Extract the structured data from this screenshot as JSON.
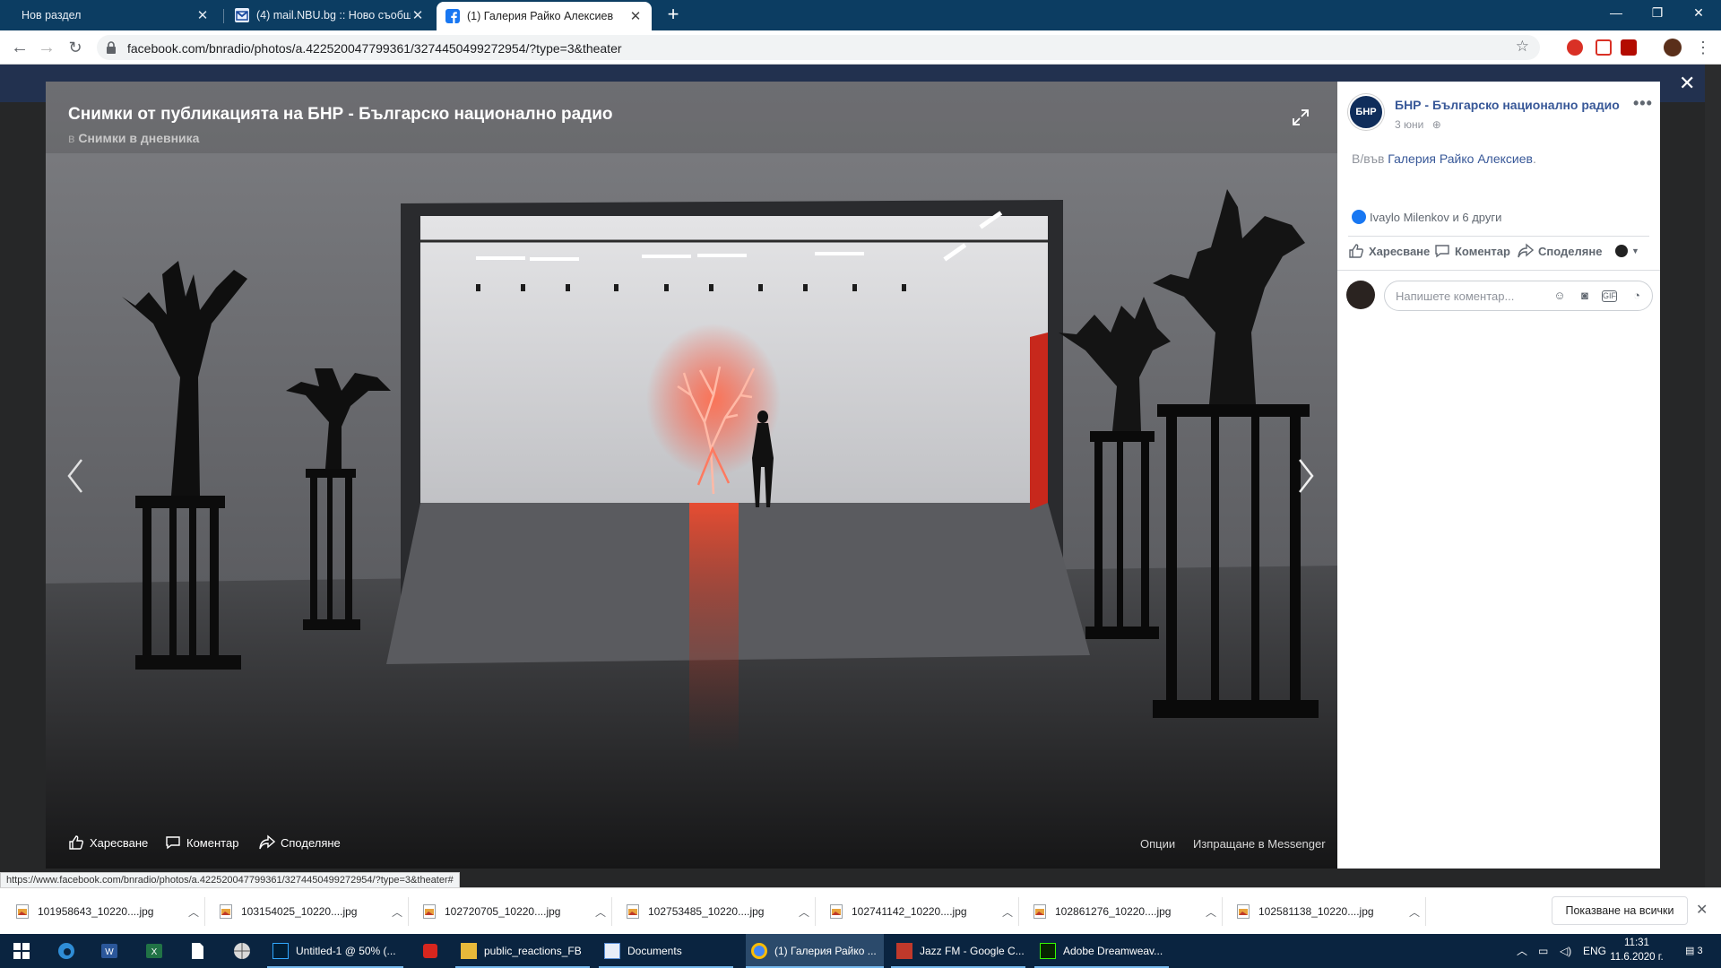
{
  "browser": {
    "tabs": [
      {
        "label": "Нов раздел",
        "active": false
      },
      {
        "label": "(4) mail.NBU.bg :: Ново съобщен",
        "active": false
      },
      {
        "label": "(1) Галерия Райко Алексиев",
        "active": true
      }
    ],
    "url": "facebook.com/bnradio/photos/a.422520047799361/3274450499272954/?type=3&theater",
    "status_url": "https://www.facebook.com/bnradio/photos/a.422520047799361/3274450499272954/?type=3&theater#"
  },
  "theater": {
    "title": "Снимки от публикацията на БНР - Българско национално радио",
    "subtitle_prefix": "в",
    "subtitle_album": "Снимки в дневника",
    "actions": {
      "like": "Харесване",
      "comment": "Коментар",
      "share": "Споделяне",
      "options": "Опции",
      "send_messenger": "Изпращане в Messenger"
    }
  },
  "post": {
    "avatar_text": "БНР",
    "page_name": "БНР - Българско национално радио",
    "date": "3 юни",
    "location_prefix": "В/във",
    "location_name": "Галерия Райко Алексиев",
    "reactions_text": "Ivaylo Milenkov и 6 други",
    "actions": {
      "like": "Харесване",
      "comment": "Коментар",
      "share": "Споделяне"
    },
    "comment_placeholder": "Напишете коментар...",
    "gif_label": "GIF"
  },
  "downloads": {
    "items": [
      "101958643_10220....jpg",
      "103154025_10220....jpg",
      "102720705_10220....jpg",
      "102753485_10220....jpg",
      "102741142_10220....jpg",
      "102861276_10220....jpg",
      "102581138_10220....jpg"
    ],
    "show_all": "Показване на всички"
  },
  "taskbar": {
    "apps": [
      {
        "label": "Untitled-1 @ 50% (...",
        "icon": "photoshop-icon",
        "color": "#001e36"
      },
      {
        "label": "public_reactions_FB",
        "icon": "folder-icon",
        "color": "#e8b93a"
      },
      {
        "label": "Documents",
        "icon": "documents-icon",
        "color": "#5a8fd6"
      },
      {
        "label": "(1) Галерия Райко ...",
        "icon": "chrome-icon",
        "color": "#4285f4"
      },
      {
        "label": "Jazz FM - Google C...",
        "icon": "jazzfm-icon",
        "color": "#c0392b"
      },
      {
        "label": "Adobe Dreamweav...",
        "icon": "dreamweaver-icon",
        "color": "#35fa00"
      }
    ],
    "lang": "ENG",
    "time": "11:31",
    "date": "11.6.2020 г.",
    "notifications": "3"
  },
  "colors": {
    "fb_blue": "#385898",
    "tab_strip": "#0c3d62",
    "taskbar": "#0a2440"
  }
}
